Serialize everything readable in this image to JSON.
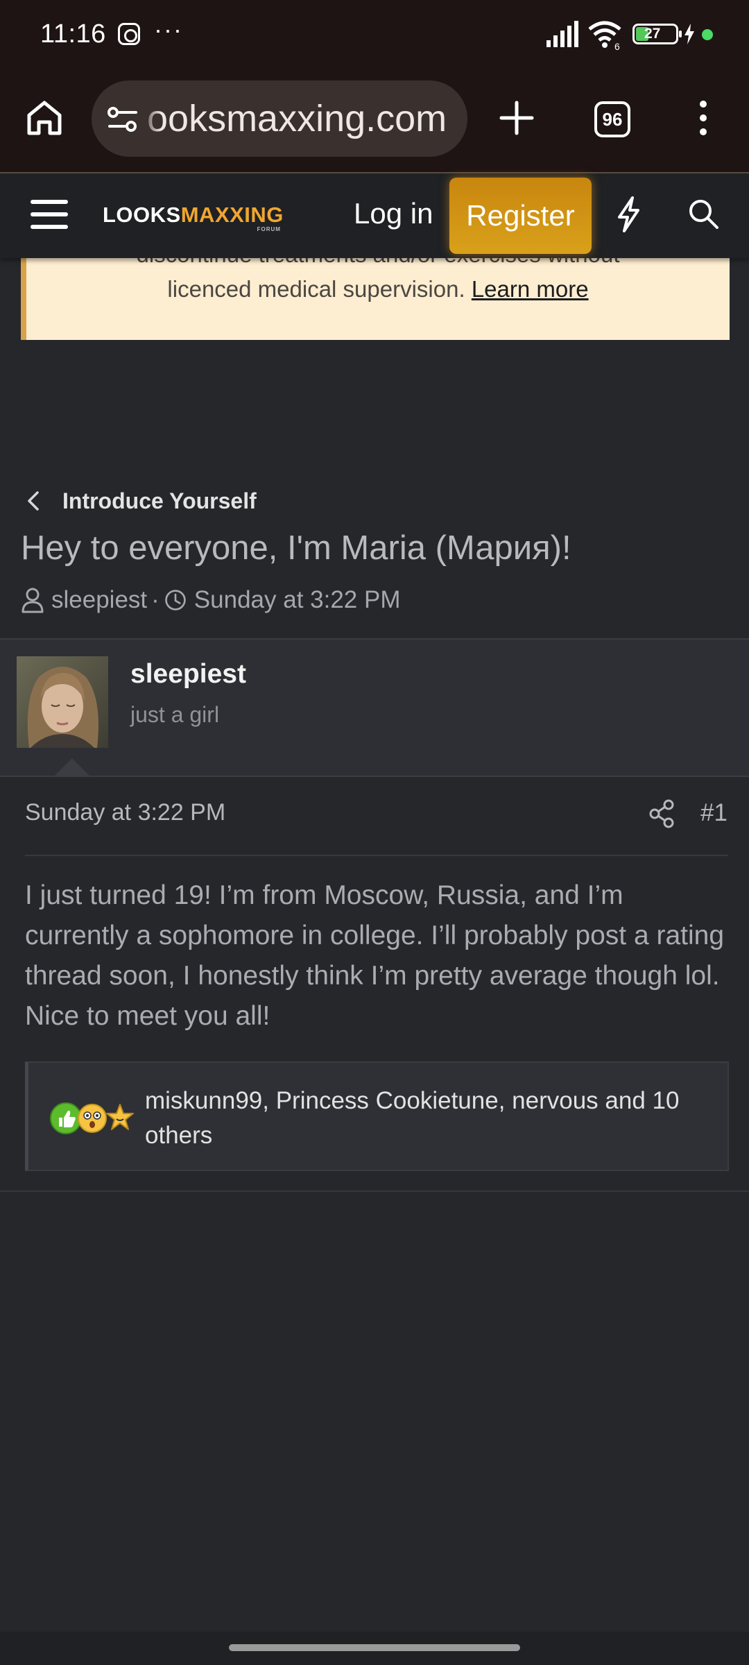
{
  "status_bar": {
    "time": "11:16",
    "dots": "···",
    "battery": "27"
  },
  "browser": {
    "url_text": "ooksmaxxing.com",
    "tab_count": "96"
  },
  "site_header": {
    "logo_looks": "LOOKS",
    "logo_maxxing": "MAXXING",
    "logo_forum": "FORUM",
    "login_label": "Log in",
    "register_label": "Register"
  },
  "notice": {
    "line1": "discontinue treatments and/or exercises without",
    "line2_text": "licenced medical supervision. ",
    "learn_more": "Learn more"
  },
  "breadcrumb": {
    "label": "Introduce Yourself"
  },
  "thread": {
    "title": "Hey to everyone, I'm Maria (Мария)!",
    "author": "sleepiest",
    "separator": "·",
    "date": "Sunday at 3:22 PM"
  },
  "user": {
    "name": "sleepiest",
    "title": "just a girl"
  },
  "post": {
    "date": "Sunday at 3:22 PM",
    "number": "#1",
    "body": "I just turned 19! I’m from Moscow, Russia, and I’m currently a sophomore in college. I’ll probably post a rating thread soon, I honestly think I’m pretty average though lol. Nice to meet you all!",
    "reactions_text": "miskunn99, Princess Cookietune, nervous and 10 others"
  },
  "colors": {
    "accent": "#f0a630",
    "register_bg": "#d9a11a",
    "notice_bg": "#fdedd1",
    "page_bg": "#25272b"
  },
  "icons": {
    "reaction_like": "thumbs-up-icon",
    "reaction_wow": "flushed-face-icon",
    "reaction_star": "star-face-icon"
  }
}
